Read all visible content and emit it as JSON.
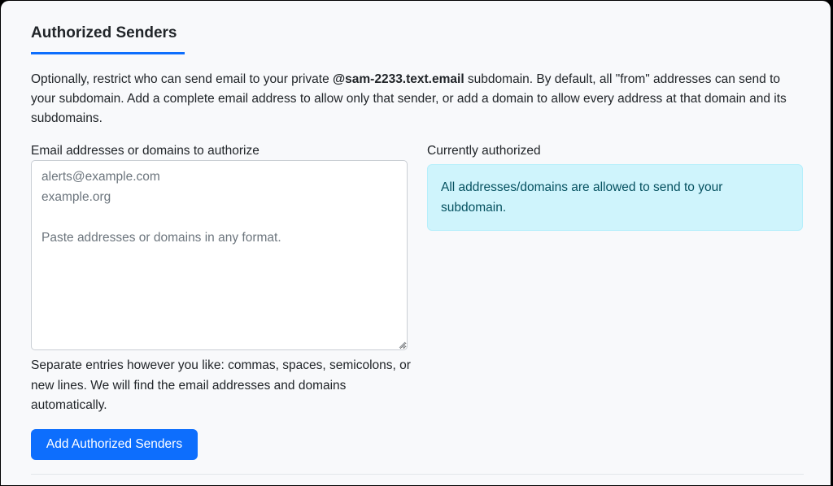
{
  "section": {
    "title": "Authorized Senders",
    "intro_before": "Optionally, restrict who can send email to your private ",
    "intro_domain": "@sam-2233.text.email",
    "intro_after": " subdomain. By default, all \"from\" addresses can send to your subdomain. Add a complete email address to allow only that sender, or add a domain to allow every address at that domain and its subdomains."
  },
  "form": {
    "textarea_label": "Email addresses or domains to authorize",
    "textarea_placeholder": "alerts@example.com\nexample.org\n\nPaste addresses or domains in any format.",
    "help_text": "Separate entries however you like: commas, spaces, semicolons, or new lines. We will find the email addresses and domains automatically.",
    "submit_label": "Add Authorized Senders"
  },
  "current": {
    "label": "Currently authorized",
    "message": "All addresses/domains are allowed to send to your subdomain."
  },
  "colors": {
    "accent": "#0d6efd",
    "info_background": "#cff4fc",
    "info_text": "#055160"
  }
}
